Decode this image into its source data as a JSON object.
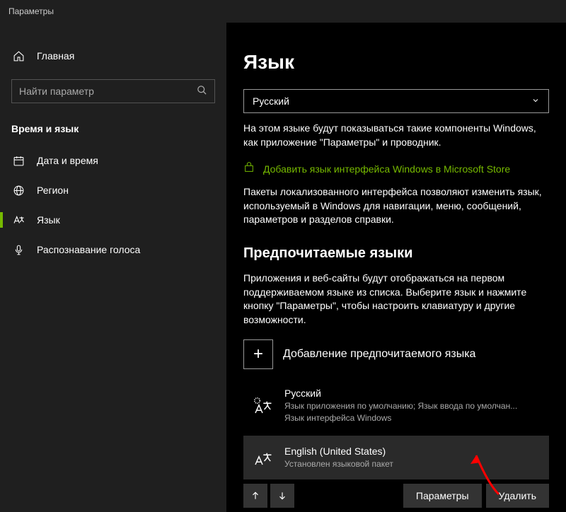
{
  "window": {
    "title": "Параметры"
  },
  "sidebar": {
    "home": "Главная",
    "search_placeholder": "Найти параметр",
    "category": "Время и язык",
    "items": [
      {
        "label": "Дата и время"
      },
      {
        "label": "Регион"
      },
      {
        "label": "Язык"
      },
      {
        "label": "Распознавание голоса"
      }
    ]
  },
  "main": {
    "title": "Язык",
    "display_lang": {
      "selected": "Русский"
    },
    "display_lang_desc": "На этом языке будут показываться такие компоненты Windows, как приложение \"Параметры\" и проводник.",
    "store_link": "Добавить язык интерфейса Windows в Microsoft Store",
    "pack_desc": "Пакеты локализованного интерфейса позволяют изменить язык, используемый в Windows для навигации, меню, сообщений, параметров и разделов справки.",
    "preferred_title": "Предпочитаемые языки",
    "preferred_desc": "Приложения и веб-сайты будут отображаться на первом поддерживаемом языке из списка. Выберите язык и нажмите кнопку \"Параметры\", чтобы настроить клавиатуру и другие возможности.",
    "add_lang": "Добавление предпочитаемого языка",
    "languages": [
      {
        "name": "Русский",
        "meta1": "Язык приложения по умолчанию; Язык ввода по умолчан...",
        "meta2": "Язык интерфейса Windows"
      },
      {
        "name": "English (United States)",
        "meta1": "Установлен языковой пакет",
        "meta2": ""
      }
    ],
    "actions": {
      "options": "Параметры",
      "remove": "Удалить"
    }
  }
}
